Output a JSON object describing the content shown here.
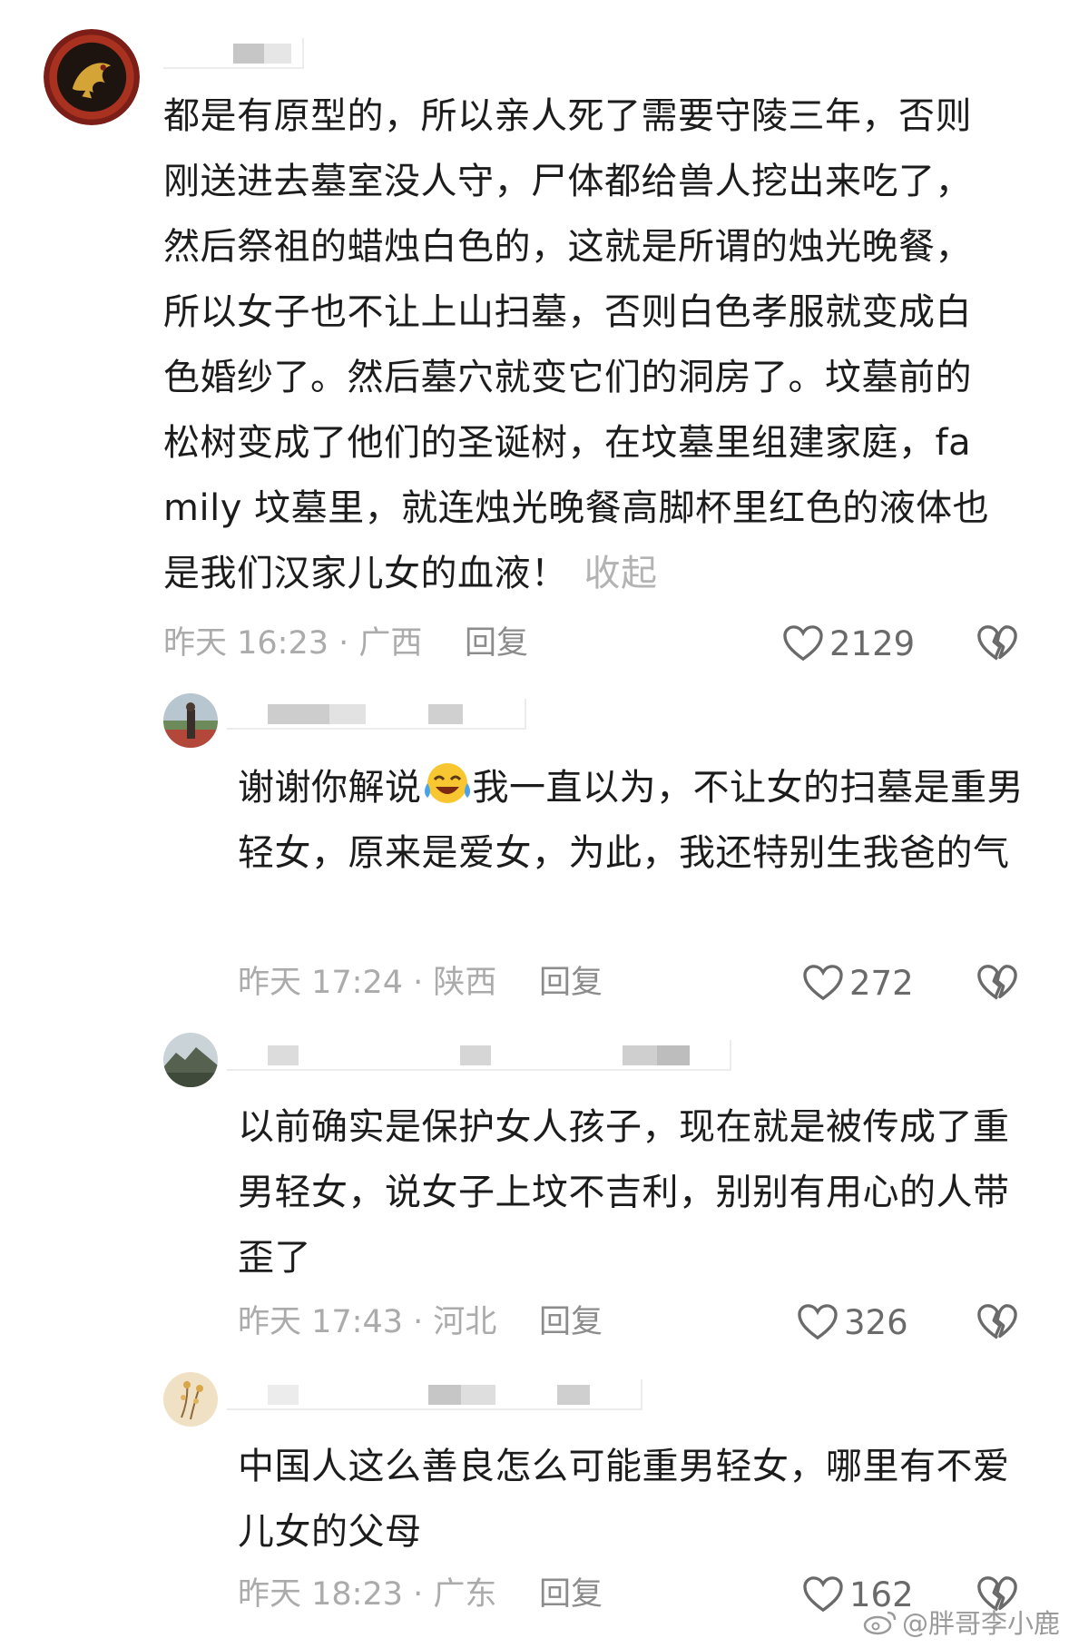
{
  "comments": [
    {
      "text": "都是有原型的，所以亲人死了需要守陵三年，否则刚送进去墓室没人守，尸体都给兽人挖出来吃了，然后祭祖的蜡烛白色的，这就是所谓的烛光晚餐，所以女子也不让上山扫墓，否则白色孝服就变成白色婚纱了。然后墓穴就变它们的洞房了。坟墓前的松树变成了他们的圣诞树，在坟墓里组建家庭，family 坟墓里，就连烛光晚餐高脚杯里红色的液体也是我们汉家儿女的血液！",
      "collapse": "收起",
      "meta": "昨天 16:23 · 广西",
      "reply": "回复",
      "likes": "2129",
      "avatar_icon": "dragon-emblem-icon"
    },
    {
      "text_before_emoji": "谢谢你解说",
      "emoji": "laughing-tears-emoji",
      "text_after_emoji": "我一直以为，不让女的扫墓是重男轻女，原来是爱女，为此，我还特别生我爸的气",
      "meta": "昨天 17:24 · 陕西",
      "reply": "回复",
      "likes": "272",
      "avatar_icon": "person-field-photo-icon"
    },
    {
      "text": "以前确实是保护女人孩子，现在就是被传成了重男轻女，说女子上坟不吉利，别别有用心的人带歪了",
      "meta": "昨天 17:43 · 河北",
      "reply": "回复",
      "likes": "326",
      "avatar_icon": "mountain-landscape-icon"
    },
    {
      "text": "中国人这么善良怎么可能重男轻女，哪里有不爱儿女的父母",
      "meta": "昨天 18:23 · 广东",
      "reply": "回复",
      "likes": "162",
      "avatar_icon": "floral-painting-icon"
    }
  ],
  "watermark": "@胖哥李小鹿",
  "colors": {
    "text": "#1c1c1c",
    "meta": "#ababab",
    "reply": "#8c8c8c",
    "like_icon": "#6a6a6a",
    "avatar_red": "#9e2a1f"
  }
}
